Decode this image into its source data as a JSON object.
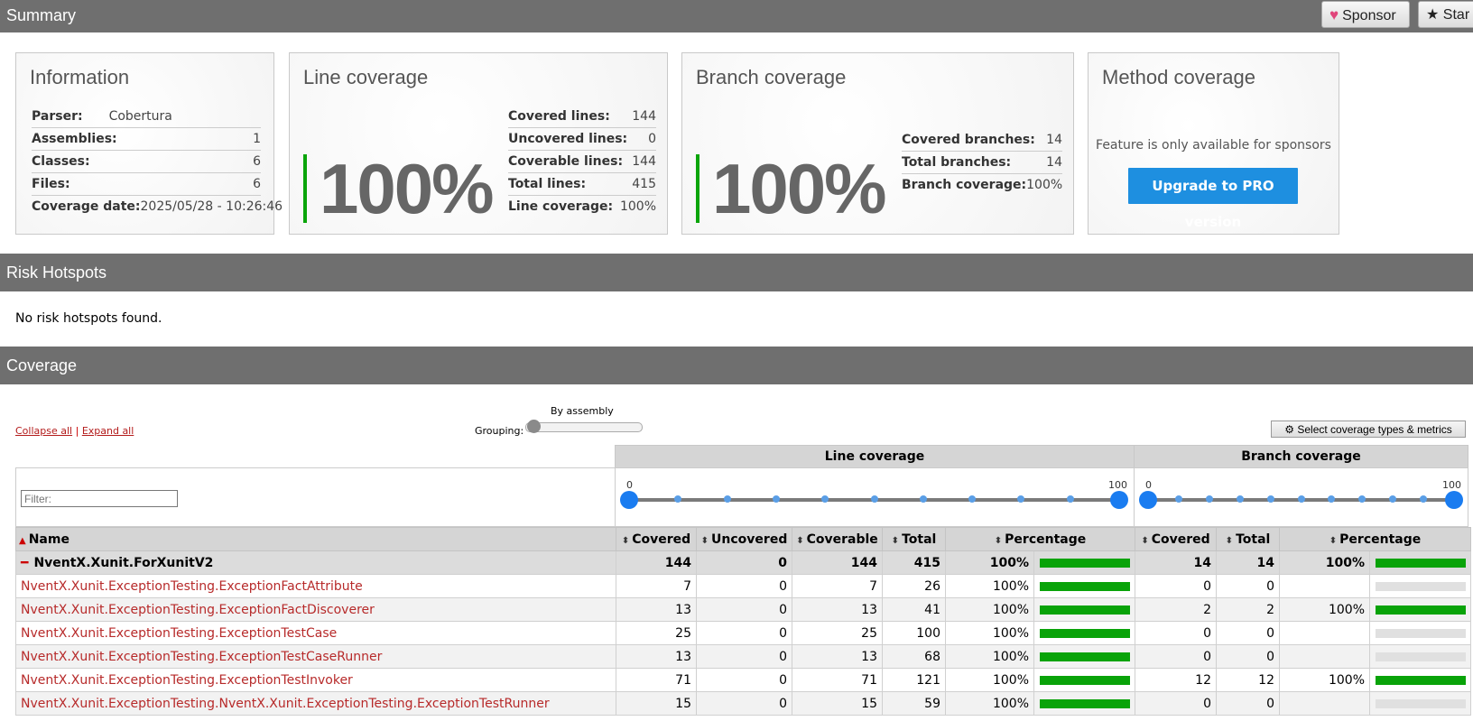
{
  "header": {
    "summary_title": "Summary",
    "sponsor_label": "Sponsor",
    "star_label": "Star"
  },
  "information": {
    "title": "Information",
    "rows": [
      {
        "label": "Parser:",
        "value": "Cobertura"
      },
      {
        "label": "Assemblies:",
        "value": "1"
      },
      {
        "label": "Classes:",
        "value": "6"
      },
      {
        "label": "Files:",
        "value": "6"
      },
      {
        "label": "Coverage date:",
        "value": "2025/05/28 - 10:26:46"
      }
    ]
  },
  "line_coverage": {
    "title": "Line coverage",
    "big_value": "100%",
    "rows": [
      {
        "label": "Covered lines:",
        "value": "144"
      },
      {
        "label": "Uncovered lines:",
        "value": "0"
      },
      {
        "label": "Coverable lines:",
        "value": "144"
      },
      {
        "label": "Total lines:",
        "value": "415"
      },
      {
        "label": "Line coverage:",
        "value": "100%"
      }
    ]
  },
  "branch_coverage": {
    "title": "Branch coverage",
    "big_value": "100%",
    "rows": [
      {
        "label": "Covered branches:",
        "value": "14"
      },
      {
        "label": "Total branches:",
        "value": "14"
      },
      {
        "label": "Branch coverage:",
        "value": "100%"
      }
    ]
  },
  "method_coverage": {
    "title": "Method coverage",
    "note": "Feature is only available for sponsors",
    "button": "Upgrade to PRO version"
  },
  "risk": {
    "title": "Risk Hotspots",
    "message": "No risk hotspots found."
  },
  "coverage": {
    "title": "Coverage",
    "collapse_all": "Collapse all",
    "separator": " | ",
    "expand_all": "Expand all",
    "grouping_label": "Grouping:",
    "grouping_value": "By assembly",
    "select_metrics": "Select coverage types & metrics",
    "filter_placeholder": "Filter:",
    "line_header": "Line coverage",
    "branch_header": "Branch coverage",
    "range_min": "0",
    "range_max": "100",
    "columns": {
      "name": "Name",
      "covered": "Covered",
      "uncovered": "Uncovered",
      "coverable": "Coverable",
      "total": "Total",
      "percentage": "Percentage",
      "b_covered": "Covered",
      "b_total": "Total",
      "b_percentage": "Percentage"
    },
    "assembly": {
      "name": "NventX.Xunit.ForXunitV2",
      "covered": "144",
      "uncovered": "0",
      "coverable": "144",
      "total": "415",
      "percentage": "100%",
      "line_pct": 100,
      "b_covered": "14",
      "b_total": "14",
      "b_percentage": "100%",
      "branch_pct": 100
    },
    "rows": [
      {
        "name": "NventX.Xunit.ExceptionTesting.ExceptionFactAttribute",
        "covered": "7",
        "uncovered": "0",
        "coverable": "7",
        "total": "26",
        "percentage": "100%",
        "line_pct": 100,
        "b_covered": "0",
        "b_total": "0",
        "b_percentage": "",
        "branch_pct": 0
      },
      {
        "name": "NventX.Xunit.ExceptionTesting.ExceptionFactDiscoverer",
        "covered": "13",
        "uncovered": "0",
        "coverable": "13",
        "total": "41",
        "percentage": "100%",
        "line_pct": 100,
        "b_covered": "2",
        "b_total": "2",
        "b_percentage": "100%",
        "branch_pct": 100
      },
      {
        "name": "NventX.Xunit.ExceptionTesting.ExceptionTestCase",
        "covered": "25",
        "uncovered": "0",
        "coverable": "25",
        "total": "100",
        "percentage": "100%",
        "line_pct": 100,
        "b_covered": "0",
        "b_total": "0",
        "b_percentage": "",
        "branch_pct": 0
      },
      {
        "name": "NventX.Xunit.ExceptionTesting.ExceptionTestCaseRunner",
        "covered": "13",
        "uncovered": "0",
        "coverable": "13",
        "total": "68",
        "percentage": "100%",
        "line_pct": 100,
        "b_covered": "0",
        "b_total": "0",
        "b_percentage": "",
        "branch_pct": 0
      },
      {
        "name": "NventX.Xunit.ExceptionTesting.ExceptionTestInvoker",
        "covered": "71",
        "uncovered": "0",
        "coverable": "71",
        "total": "121",
        "percentage": "100%",
        "line_pct": 100,
        "b_covered": "12",
        "b_total": "12",
        "b_percentage": "100%",
        "branch_pct": 100
      },
      {
        "name": "NventX.Xunit.ExceptionTesting.NventX.Xunit.ExceptionTesting.ExceptionTestRunner",
        "covered": "15",
        "uncovered": "0",
        "coverable": "15",
        "total": "59",
        "percentage": "100%",
        "line_pct": 100,
        "b_covered": "0",
        "b_total": "0",
        "b_percentage": "",
        "branch_pct": 0
      }
    ]
  }
}
